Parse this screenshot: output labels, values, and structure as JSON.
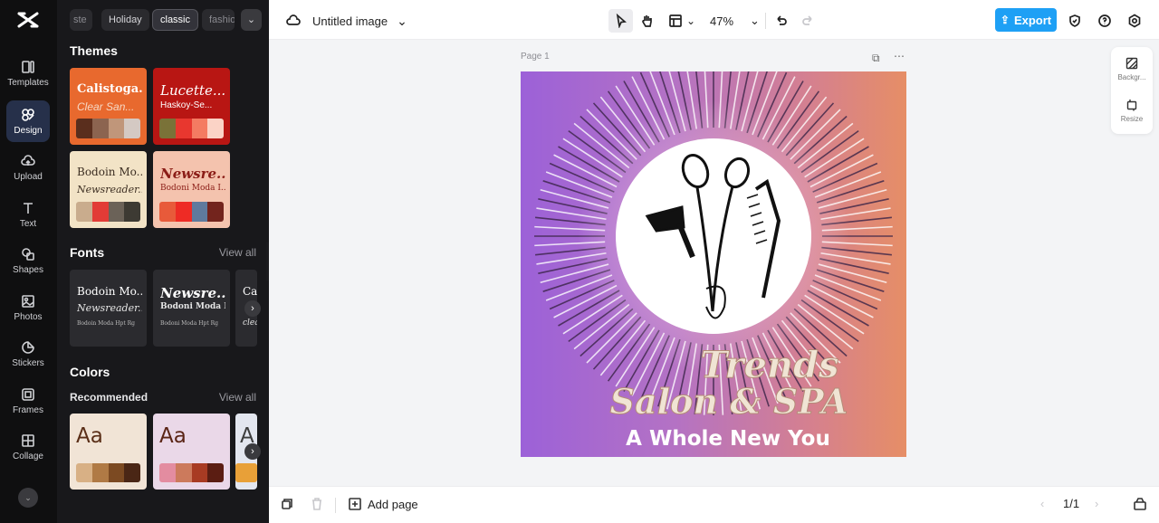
{
  "doc": {
    "title": "Untitled image"
  },
  "nav": [
    {
      "label": "Templates",
      "icon": "templates-icon"
    },
    {
      "label": "Design",
      "icon": "design-icon"
    },
    {
      "label": "Upload",
      "icon": "upload-icon"
    },
    {
      "label": "Text",
      "icon": "text-icon"
    },
    {
      "label": "Shapes",
      "icon": "shapes-icon"
    },
    {
      "label": "Photos",
      "icon": "photos-icon"
    },
    {
      "label": "Stickers",
      "icon": "stickers-icon"
    },
    {
      "label": "Frames",
      "icon": "frames-icon"
    },
    {
      "label": "Collage",
      "icon": "collage-icon"
    }
  ],
  "chips": [
    "ste",
    "Holiday",
    "classic",
    "fashio"
  ],
  "themes": {
    "title": "Themes",
    "cards": [
      {
        "t1": "Calistoga...",
        "t2": "Clear San...",
        "bg": "#e8692e",
        "fg": "#ffffff",
        "swatches": [
          "#5a2e1d",
          "#8c6450",
          "#c0967a",
          "#d4c9c3"
        ]
      },
      {
        "t1": "Lucette...",
        "t2": "Haskoy-Se...",
        "bg": "#b81613",
        "fg": "#ffffff",
        "swatches": [
          "#7a7238",
          "#e8372f",
          "#f47b62",
          "#fbd3c6"
        ]
      },
      {
        "t1": "Bodoin Mo...",
        "t2": "Newsreader...",
        "bg": "#f2e3c6",
        "fg": "#3c2e22",
        "swatches": [
          "#c9ac8d",
          "#e23b36",
          "#6b6258",
          "#3d3a33"
        ]
      },
      {
        "t1": "Newsre...",
        "t2": "Bodoni Moda I...",
        "bg": "#f4c3ae",
        "fg": "#8b1d17",
        "swatches": [
          "#e85a3a",
          "#ee2b25",
          "#5f7a9d",
          "#73241d"
        ]
      }
    ]
  },
  "fonts": {
    "title": "Fonts",
    "view_all": "View all",
    "cards": [
      {
        "f1": "Bodoin Mo...",
        "f2": "Newsreader...",
        "f3": "Bodoin Moda Hpt Rg"
      },
      {
        "f1": "Newsre...",
        "f2": "Bodoni Moda I...",
        "f3": "Bodoni Moda Hpt Rg"
      },
      {
        "f1": "Ca",
        "f2": "clea",
        "f3": ""
      }
    ]
  },
  "colors": {
    "title": "Colors",
    "recommended": "Recommended",
    "view_all": "View all",
    "cards": [
      {
        "aa": "Aa",
        "bg": "#f1e4d6",
        "fg": "#5a2e17",
        "swatches": [
          "#d8b085",
          "#b07a45",
          "#7c4a22",
          "#4a2615"
        ]
      },
      {
        "aa": "Aa",
        "bg": "#ead8e8",
        "fg": "#5a2415",
        "swatches": [
          "#e38ca0",
          "#cc7a5c",
          "#a83b23",
          "#5b1d12"
        ]
      },
      {
        "aa": "A",
        "bg": "#e3e6ef",
        "fg": "#3d3d3d",
        "swatches": [
          "#e8a038"
        ]
      }
    ]
  },
  "toolbar": {
    "zoom": "47%",
    "export": "Export"
  },
  "page": {
    "label": "Page 1"
  },
  "right_tools": [
    {
      "label": "Backgr..."
    },
    {
      "label": "Resize"
    }
  ],
  "design": {
    "line1": "Trends",
    "line2": "Salon & SPA",
    "line3": "A Whole New You"
  },
  "bottom": {
    "add_page": "Add page",
    "pager": "1/1"
  },
  "accent": "#1ea0f5"
}
